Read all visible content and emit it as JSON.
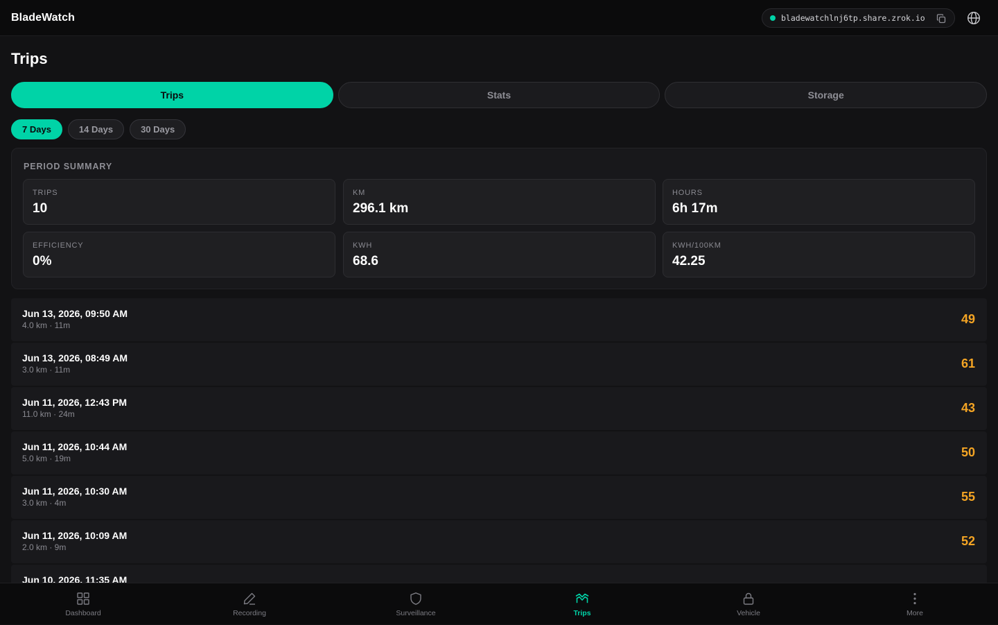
{
  "app": {
    "title": "BladeWatch",
    "share_url": "bladewatchlnj6tp.share.zrok.io",
    "accent": "#00d3a7",
    "score_color": "#f5a524"
  },
  "page": {
    "title": "Trips"
  },
  "tabs": [
    {
      "label": "Trips",
      "active": true
    },
    {
      "label": "Stats",
      "active": false
    },
    {
      "label": "Storage",
      "active": false
    }
  ],
  "ranges": [
    {
      "label": "7 Days",
      "active": true
    },
    {
      "label": "14 Days",
      "active": false
    },
    {
      "label": "30 Days",
      "active": false
    }
  ],
  "summary": {
    "heading": "PERIOD SUMMARY",
    "stats": [
      {
        "label": "TRIPS",
        "value": "10"
      },
      {
        "label": "KM",
        "value": "296.1 km"
      },
      {
        "label": "HOURS",
        "value": "6h 17m"
      },
      {
        "label": "EFFICIENCY",
        "value": "0%"
      },
      {
        "label": "KWH",
        "value": "68.6"
      },
      {
        "label": "KWH/100KM",
        "value": "42.25"
      }
    ]
  },
  "trips": [
    {
      "date": "Jun 13, 2026, 09:50 AM",
      "meta": "4.0 km · 11m",
      "score": "49"
    },
    {
      "date": "Jun 13, 2026, 08:49 AM",
      "meta": "3.0 km · 11m",
      "score": "61"
    },
    {
      "date": "Jun 11, 2026, 12:43 PM",
      "meta": "11.0 km · 24m",
      "score": "43"
    },
    {
      "date": "Jun 11, 2026, 10:44 AM",
      "meta": "5.0 km · 19m",
      "score": "50"
    },
    {
      "date": "Jun 11, 2026, 10:30 AM",
      "meta": "3.0 km · 4m",
      "score": "55"
    },
    {
      "date": "Jun 11, 2026, 10:09 AM",
      "meta": "2.0 km · 9m",
      "score": "52"
    },
    {
      "date": "Jun 10, 2026, 11:35 AM",
      "meta": "",
      "score": ""
    }
  ],
  "nav": [
    {
      "label": "Dashboard",
      "icon": "grid-icon",
      "active": false
    },
    {
      "label": "Recording",
      "icon": "pen-icon",
      "active": false
    },
    {
      "label": "Surveillance",
      "icon": "shield-icon",
      "active": false
    },
    {
      "label": "Trips",
      "icon": "trips-icon",
      "active": true
    },
    {
      "label": "Vehicle",
      "icon": "lock-icon",
      "active": false
    },
    {
      "label": "More",
      "icon": "more-vertical-icon",
      "active": false
    }
  ]
}
